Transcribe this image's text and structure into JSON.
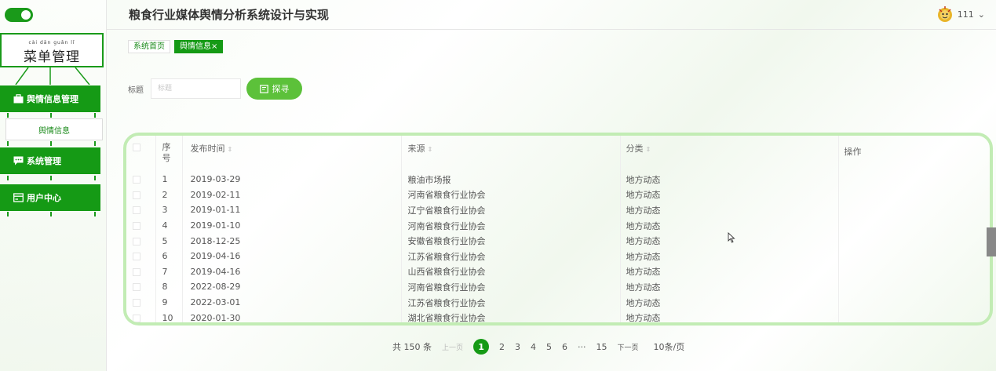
{
  "app": {
    "title": "粮食行业媒体舆情分析系统设计与实现"
  },
  "user": {
    "name": "111",
    "chevron": "⌄"
  },
  "sidebar": {
    "title_pinyin": "cài dān guǎn lǐ",
    "title": "菜单管理",
    "items": [
      {
        "label": "舆情信息管理",
        "icon": "briefcase-icon"
      },
      {
        "label": "舆情信息",
        "icon": ""
      },
      {
        "label": "系统管理",
        "icon": "chat-icon"
      },
      {
        "label": "用户中心",
        "icon": "card-icon"
      }
    ]
  },
  "tabs": [
    {
      "label": "系统首页"
    },
    {
      "label": "舆情信息",
      "close": "×"
    }
  ],
  "search": {
    "label": "标题",
    "placeholder": "标题",
    "button_label": "探寻"
  },
  "table": {
    "headers": {
      "idx": "序号",
      "time": "发布时间",
      "source": "来源",
      "category": "分类",
      "operation": "操作"
    },
    "rows": [
      {
        "idx": "1",
        "time": "2019-03-29",
        "source": "粮油市场报",
        "category": "地方动态"
      },
      {
        "idx": "2",
        "time": "2019-02-11",
        "source": "河南省粮食行业协会",
        "category": "地方动态"
      },
      {
        "idx": "3",
        "time": "2019-01-11",
        "source": "辽宁省粮食行业协会",
        "category": "地方动态"
      },
      {
        "idx": "4",
        "time": "2019-01-10",
        "source": "河南省粮食行业协会",
        "category": "地方动态"
      },
      {
        "idx": "5",
        "time": "2018-12-25",
        "source": "安徽省粮食行业协会",
        "category": "地方动态"
      },
      {
        "idx": "6",
        "time": "2019-04-16",
        "source": "江苏省粮食行业协会",
        "category": "地方动态"
      },
      {
        "idx": "7",
        "time": "2019-04-16",
        "source": "山西省粮食行业协会",
        "category": "地方动态"
      },
      {
        "idx": "8",
        "time": "2022-08-29",
        "source": "河南省粮食行业协会",
        "category": "地方动态"
      },
      {
        "idx": "9",
        "time": "2022-03-01",
        "source": "江苏省粮食行业协会",
        "category": "地方动态"
      },
      {
        "idx": "10",
        "time": "2020-01-30",
        "source": "湖北省粮食行业协会",
        "category": "地方动态"
      }
    ]
  },
  "pagination": {
    "total": "共 150 条",
    "prev": "上一页",
    "pages": [
      "1",
      "2",
      "3",
      "4",
      "5",
      "6",
      "···",
      "15"
    ],
    "current": "1",
    "next": "下一页",
    "page_size": "10条/页"
  },
  "colors": {
    "primary": "#159a15",
    "button": "#5cc13a",
    "table_border": "#c2ecb4"
  }
}
